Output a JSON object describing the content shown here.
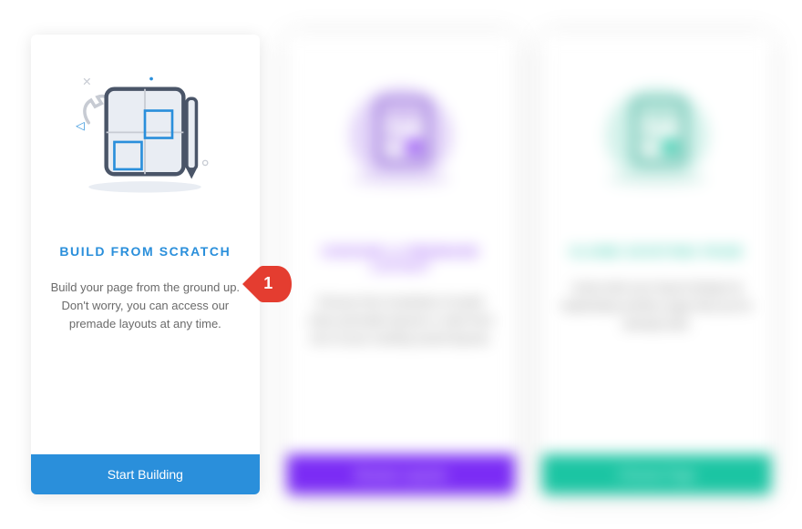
{
  "cards": [
    {
      "title": "BUILD FROM SCRATCH",
      "desc": "Build your page from the ground up. Don't worry, you can access our premade layouts at any time.",
      "button": "Start Building",
      "title_color": "#2a8fdb",
      "button_color": "#2a8fdb"
    },
    {
      "title": "CHOOSE A PREMADE LAYOUT",
      "desc": "Choose from hundreds of world-class premade layouts or start from one of your existing saved layouts.",
      "button": "Browse Layouts",
      "title_color": "#8a3df5",
      "button_color": "#7b2cf5"
    },
    {
      "title": "CLONE EXISTING PAGE",
      "desc": "Jump-start your layout design by duplicating another page that you've already built.",
      "button": "Choose Page",
      "title_color": "#1bc5a3",
      "button_color": "#1bc5a3"
    }
  ],
  "callout": {
    "number": "1",
    "bg": "#e43d30"
  }
}
